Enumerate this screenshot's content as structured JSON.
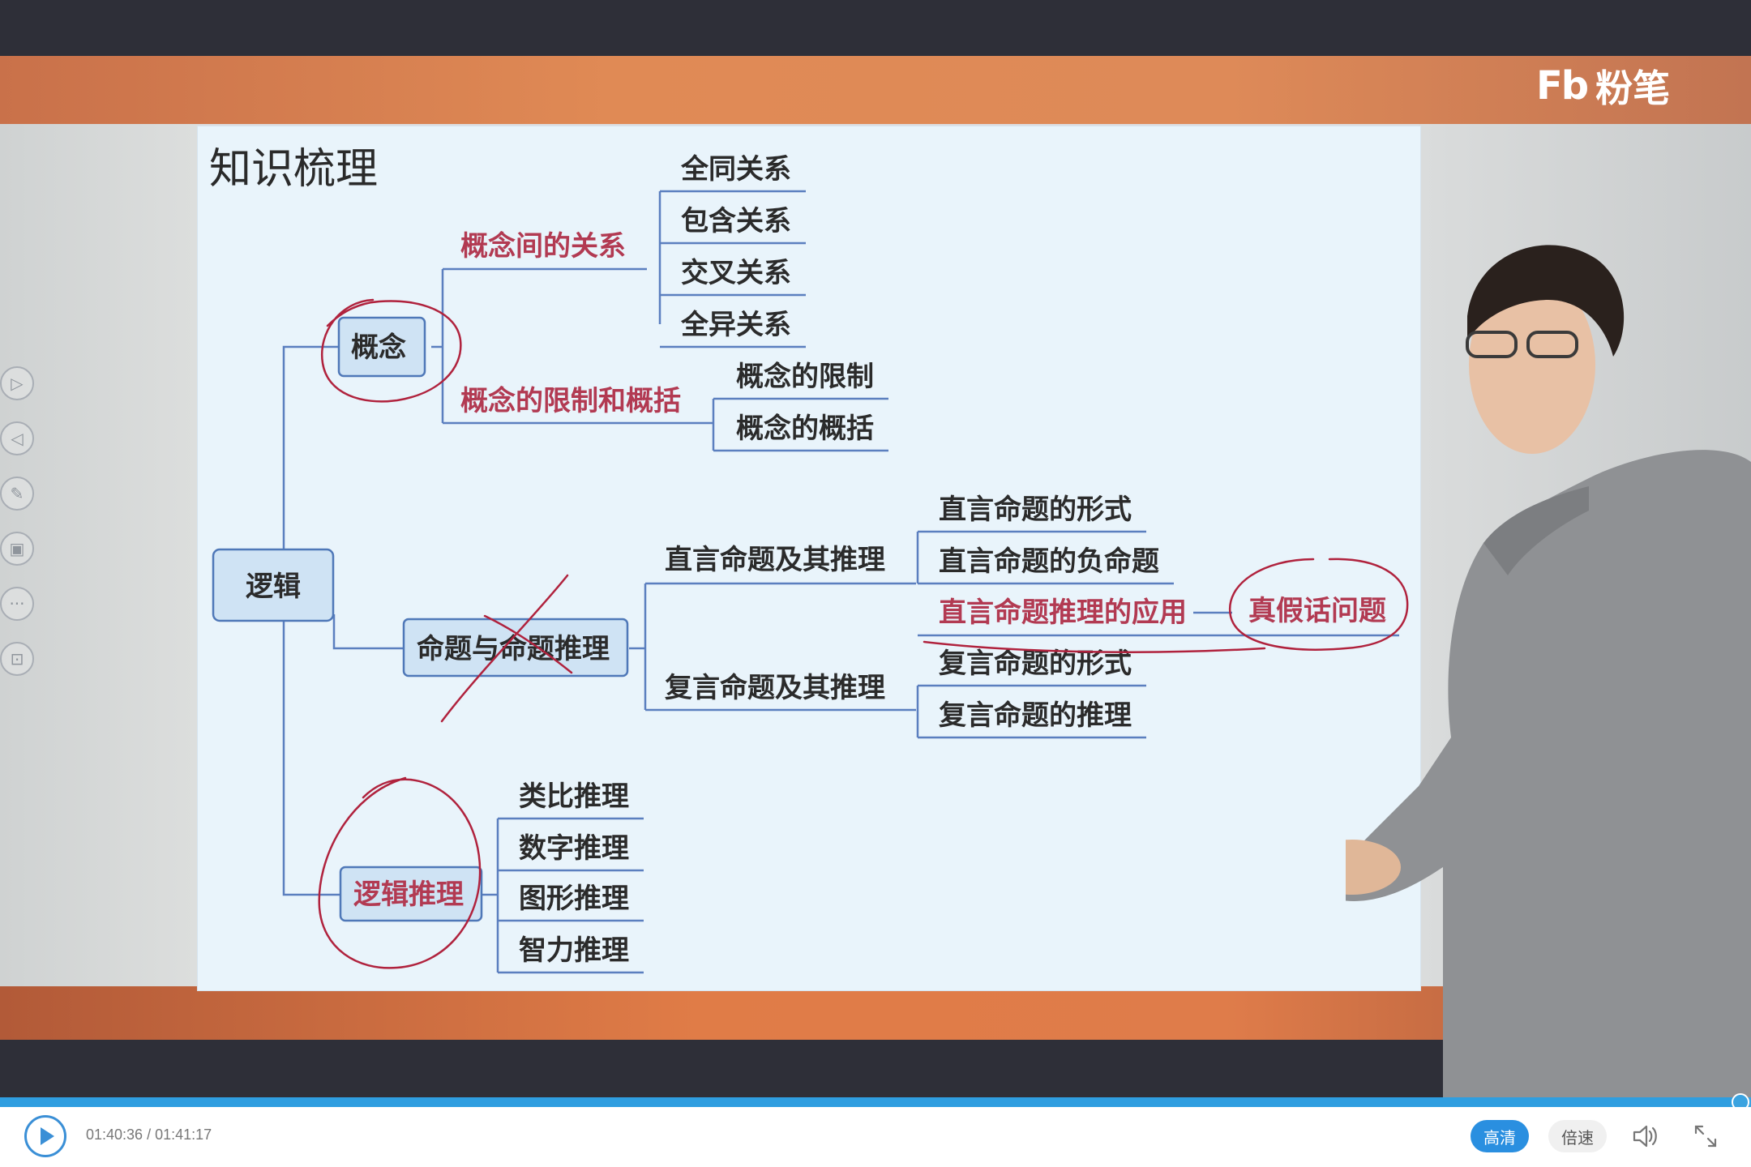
{
  "brand": {
    "logo_mark": "Fb",
    "logo_text": "粉笔"
  },
  "slide": {
    "title": "知识梳理",
    "root": "逻辑",
    "branch_concept": "概念",
    "concept_relations": "概念间的关系",
    "concept_relations_items": [
      "全同关系",
      "包含关系",
      "交叉关系",
      "全异关系"
    ],
    "concept_limits": "概念的限制和概括",
    "concept_limits_items": [
      "概念的限制",
      "概念的概括"
    ],
    "branch_proposition": "命题与命题推理",
    "categorical": "直言命题及其推理",
    "categorical_items": [
      "直言命题的形式",
      "直言命题的负命题",
      "直言命题推理的应用"
    ],
    "truth_lie": "真假话问题",
    "compound": "复言命题及其推理",
    "compound_items": [
      "复言命题的形式",
      "复言命题的推理"
    ],
    "branch_reasoning": "逻辑推理",
    "reasoning_items": [
      "类比推理",
      "数字推理",
      "图形推理",
      "智力推理"
    ]
  },
  "player": {
    "time_current": "01:40:36",
    "time_total": "01:41:17",
    "time_separator": "/",
    "progress": 0.993,
    "quality_label": "高清",
    "speed_label": "倍速",
    "accent_color": "#2a8fe0"
  },
  "side_tools": [
    {
      "icon": "play-next-icon"
    },
    {
      "icon": "play-prev-icon"
    },
    {
      "icon": "pen-icon"
    },
    {
      "icon": "screen-icon"
    },
    {
      "icon": "more-icon"
    },
    {
      "icon": "display-icon"
    }
  ]
}
